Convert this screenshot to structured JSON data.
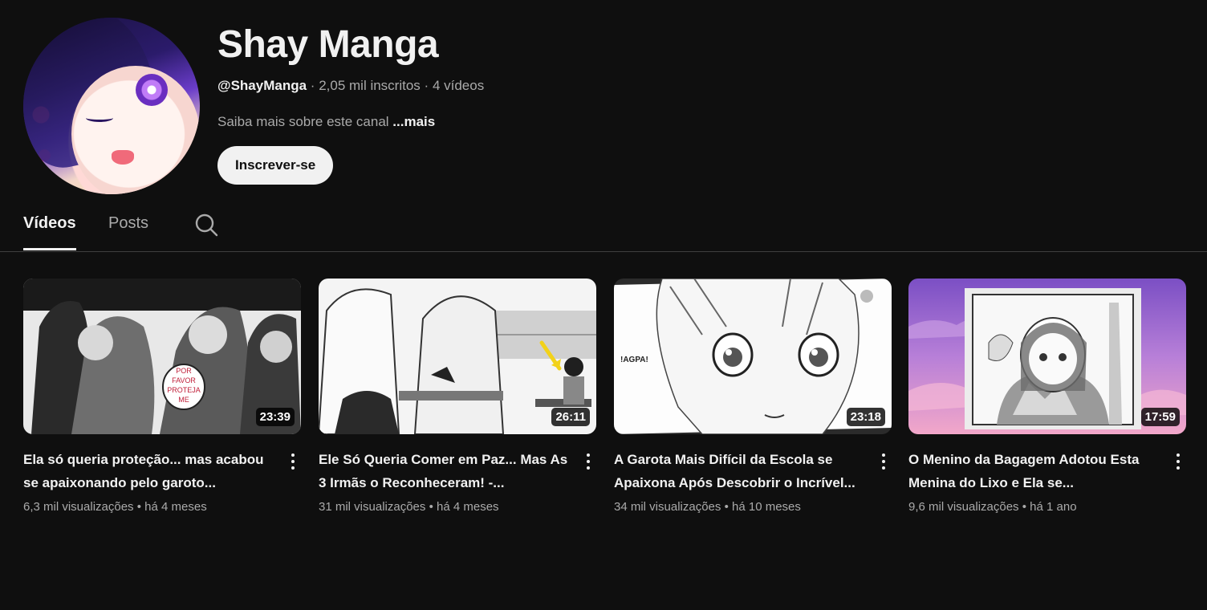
{
  "channel": {
    "name": "Shay Manga",
    "handle": "@ShayManga",
    "subscribers": "2,05 mil inscritos",
    "video_count": "4 vídeos",
    "separator": "·",
    "about_text": "Saiba mais sobre este canal",
    "about_more": "...mais",
    "subscribe_label": "Inscrever-se"
  },
  "tabs": [
    {
      "label": "Vídeos",
      "active": true
    },
    {
      "label": "Posts",
      "active": false
    }
  ],
  "videos": [
    {
      "title": "Ela só queria proteção... mas acabou se apaixonando pelo garoto...",
      "duration": "23:39",
      "views": "6,3 mil visualizações",
      "age": "há 4 meses",
      "bubble_text": "POR FAVOR PROTEJA ME"
    },
    {
      "title": "Ele Só Queria Comer em Paz... Mas As 3 Irmãs o Reconheceram! -...",
      "duration": "26:11",
      "views": "31 mil visualizações",
      "age": "há 4 meses"
    },
    {
      "title": "A Garota Mais Difícil da Escola se Apaixona Após Descobrir o Incrível...",
      "duration": "23:18",
      "views": "34 mil visualizações",
      "age": "há 10 meses",
      "sfx_text": "!AGPA!"
    },
    {
      "title": "O Menino da Bagagem Adotou Esta Menina do Lixo e Ela se...",
      "duration": "17:59",
      "views": "9,6 mil visualizações",
      "age": "há 1 ano"
    }
  ],
  "meta_separator": "•",
  "colors": {
    "background": "#0f0f0f",
    "text_primary": "#f1f1f1",
    "text_secondary": "#aaaaaa",
    "subscribe_bg": "#f1f1f1",
    "divider": "#3f3f3f"
  },
  "icons": {
    "search": "search-icon",
    "more": "more-vert-icon"
  }
}
